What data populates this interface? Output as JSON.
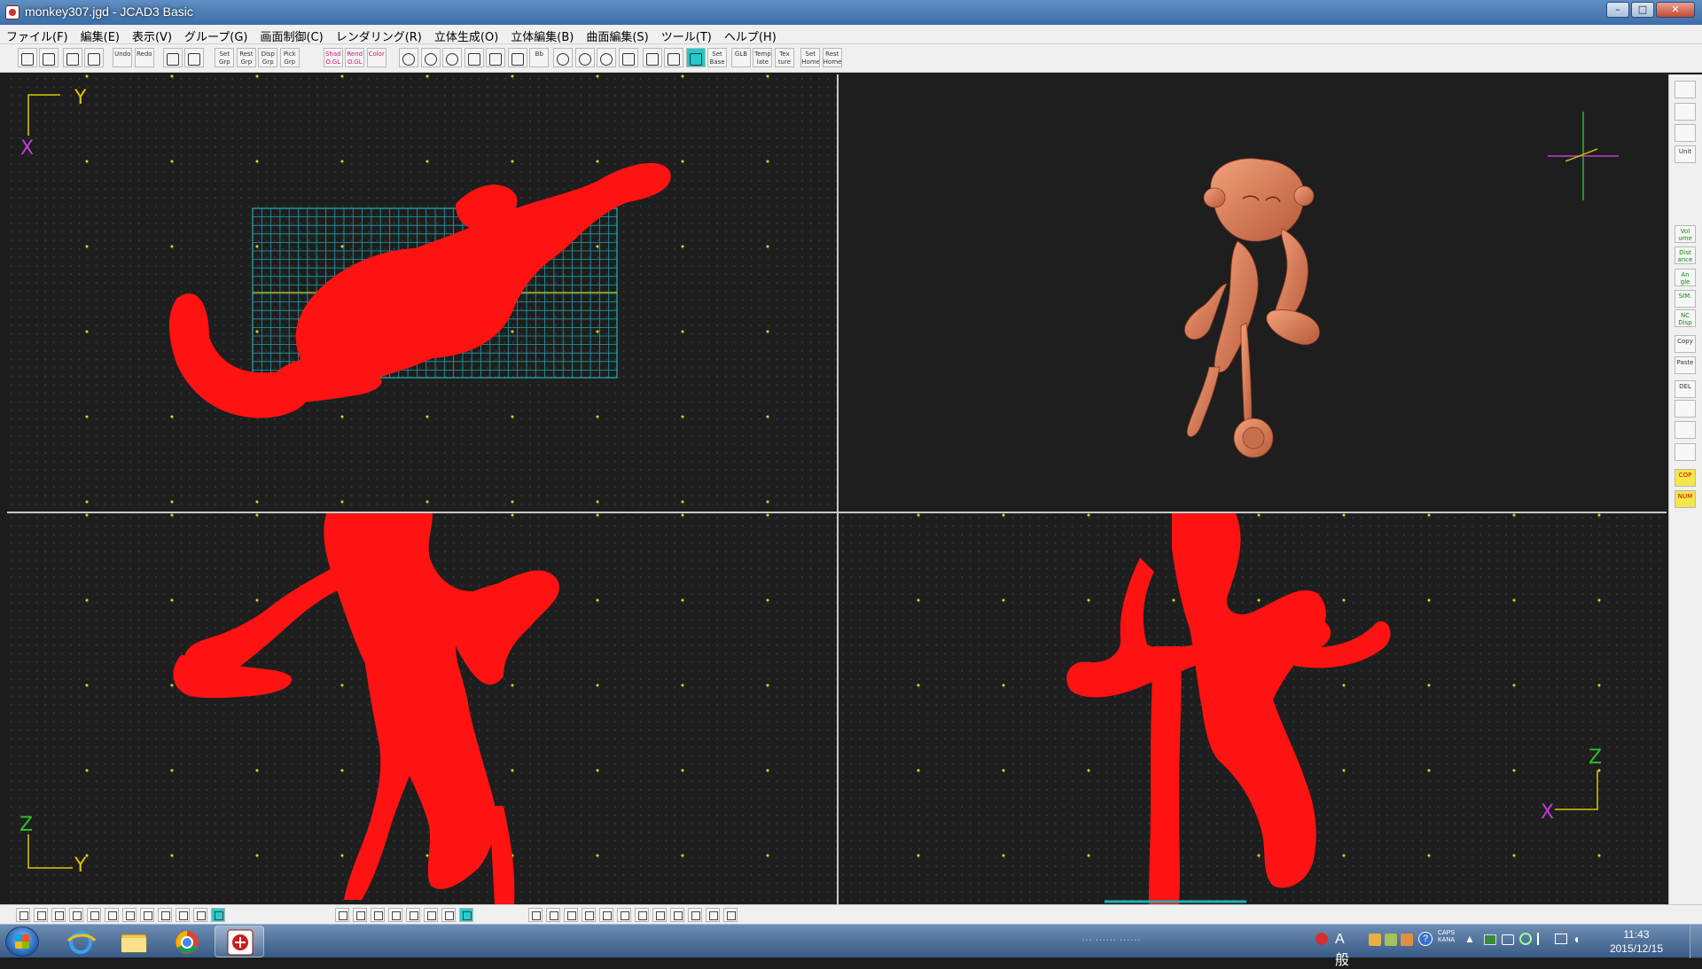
{
  "window": {
    "title": "monkey307.jgd - JCAD3 Basic",
    "controls": [
      "–",
      "□",
      "✕"
    ]
  },
  "menu": [
    "ファイル(F)",
    "編集(E)",
    "表示(V)",
    "グループ(G)",
    "画面制御(C)",
    "レンダリング(R)",
    "立体生成(O)",
    "立体編集(B)",
    "曲面編集(S)",
    "ツール(T)",
    "ヘルプ(H)"
  ],
  "toolbar": {
    "buttons": [
      {
        "name": "new-icon",
        "label": ""
      },
      {
        "name": "open-icon",
        "label": ""
      },
      {
        "name": "save-icon",
        "label": ""
      },
      {
        "name": "print-icon",
        "label": ""
      },
      {
        "name": "undo-button",
        "label": "Undo"
      },
      {
        "name": "redo-button",
        "label": "Redo"
      },
      {
        "name": "grid-view-icon",
        "label": ""
      },
      {
        "name": "quad-view-icon",
        "label": ""
      },
      {
        "name": "set-grp-button",
        "label": "Set Grp"
      },
      {
        "name": "rest-grp-button",
        "label": "Rest Grp"
      },
      {
        "name": "disp-grp-button",
        "label": "Disp Grp"
      },
      {
        "name": "pick-grp-button",
        "label": "Pick Grp"
      },
      {
        "name": "shad-ogl-button",
        "label": "Shad O.GL"
      },
      {
        "name": "rend-ogl-button",
        "label": "Rend O.GL"
      },
      {
        "name": "color-button",
        "label": "Color"
      },
      {
        "name": "zoom-in-icon",
        "label": ""
      },
      {
        "name": "zoom-out-icon",
        "label": ""
      },
      {
        "name": "zoom-fit-icon",
        "label": ""
      },
      {
        "name": "zoom-window-icon",
        "label": ""
      },
      {
        "name": "zoom-all-icon",
        "label": ""
      },
      {
        "name": "pan-hand-icon",
        "label": ""
      },
      {
        "name": "bb-button",
        "label": "Bb"
      },
      {
        "name": "rotate-view-icon",
        "label": ""
      },
      {
        "name": "zoom-view-icon",
        "label": ""
      },
      {
        "name": "zoom-box-icon",
        "label": ""
      },
      {
        "name": "frame-icon",
        "label": ""
      },
      {
        "name": "grid-on-icon",
        "label": ""
      },
      {
        "name": "grid-dots-icon",
        "label": ""
      },
      {
        "name": "grid-active-icon",
        "label": ""
      },
      {
        "name": "set-base-button",
        "label": "Set Base"
      },
      {
        "name": "glb-button",
        "label": "GLB"
      },
      {
        "name": "template-button",
        "label": "Temp late"
      },
      {
        "name": "texture-button",
        "label": "Tex ture"
      },
      {
        "name": "set-home-button",
        "label": "Set Home"
      },
      {
        "name": "rest-home-button",
        "label": "Rest Home"
      }
    ]
  },
  "views": {
    "top": {
      "axis_h": "Y",
      "axis_v": "X"
    },
    "front": {
      "axis_v": "Z",
      "axis_h": "Y"
    },
    "side": {
      "axis_v": "Z",
      "axis_h": "X"
    }
  },
  "right_toolbar": [
    {
      "name": "light-icon",
      "label": ""
    },
    {
      "name": "printer3d-icon",
      "label": ""
    },
    {
      "name": "diamond-icon",
      "label": ""
    },
    {
      "name": "unit-button",
      "label": "Unit"
    },
    {
      "name": "volume-button",
      "label": "Vol ume"
    },
    {
      "name": "distance-button",
      "label": "Dist ance"
    },
    {
      "name": "angle-button",
      "label": "An gle"
    },
    {
      "name": "sim-button",
      "label": "SIM."
    },
    {
      "name": "nc-disp-button",
      "label": "NC Disp"
    },
    {
      "name": "copy-button",
      "label": "Copy"
    },
    {
      "name": "paste-button",
      "label": "Paste"
    },
    {
      "name": "del-button",
      "label": "DEL"
    },
    {
      "name": "list-icon",
      "label": ""
    },
    {
      "name": "layers-icon",
      "label": ""
    },
    {
      "name": "tree-icon",
      "label": ""
    },
    {
      "name": "cop-button",
      "label": "COP"
    },
    {
      "name": "num-button",
      "label": "NUM"
    }
  ],
  "taskbar": {
    "ime": "A 般",
    "clock_time": "11:43",
    "clock_date": "2015/12/15",
    "caps": "CAPS",
    "kana": "KANA"
  },
  "colors": {
    "wire": "#ff1414",
    "model_shaded": "#e2865e",
    "grid_panel": "#1fb0b8",
    "accent_teal": "#23c8c8"
  }
}
